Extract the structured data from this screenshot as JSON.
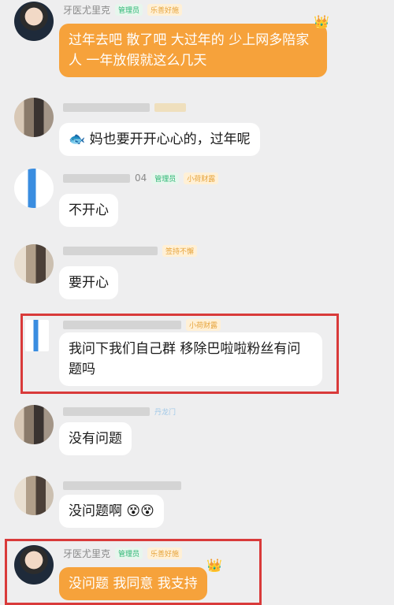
{
  "messages": [
    {
      "sender": "牙医尤里克",
      "admin_tag": "管理员",
      "title_tag": "乐善好施",
      "text": "过年去吧 散了吧 大过年的 少上网多陪家人 一年放假就这么几天"
    },
    {
      "text": "妈也要开开心心的，过年呢",
      "emoji": "🐟"
    },
    {
      "id_suffix": "04",
      "admin_tag": "管理员",
      "title_tag": "小荷财露",
      "text": "不开心"
    },
    {
      "title_tag": "签持不懈",
      "text": "要开心"
    },
    {
      "title_tag": "小荷财露",
      "text": "我问下我们自己群 移除巴啦啦粉丝有问题吗"
    },
    {
      "title_tag": "丹龙门",
      "text": "没有问题"
    },
    {
      "text": "没问题啊",
      "emoji": "😵😵"
    },
    {
      "sender": "牙医尤里克",
      "admin_tag": "管理员",
      "title_tag": "乐善好施",
      "text": "没问题 我同意 我支持"
    }
  ],
  "colors": {
    "orange_bubble": "#f6a23b",
    "highlight": "#d93a3a",
    "admin": "#2bb673"
  }
}
